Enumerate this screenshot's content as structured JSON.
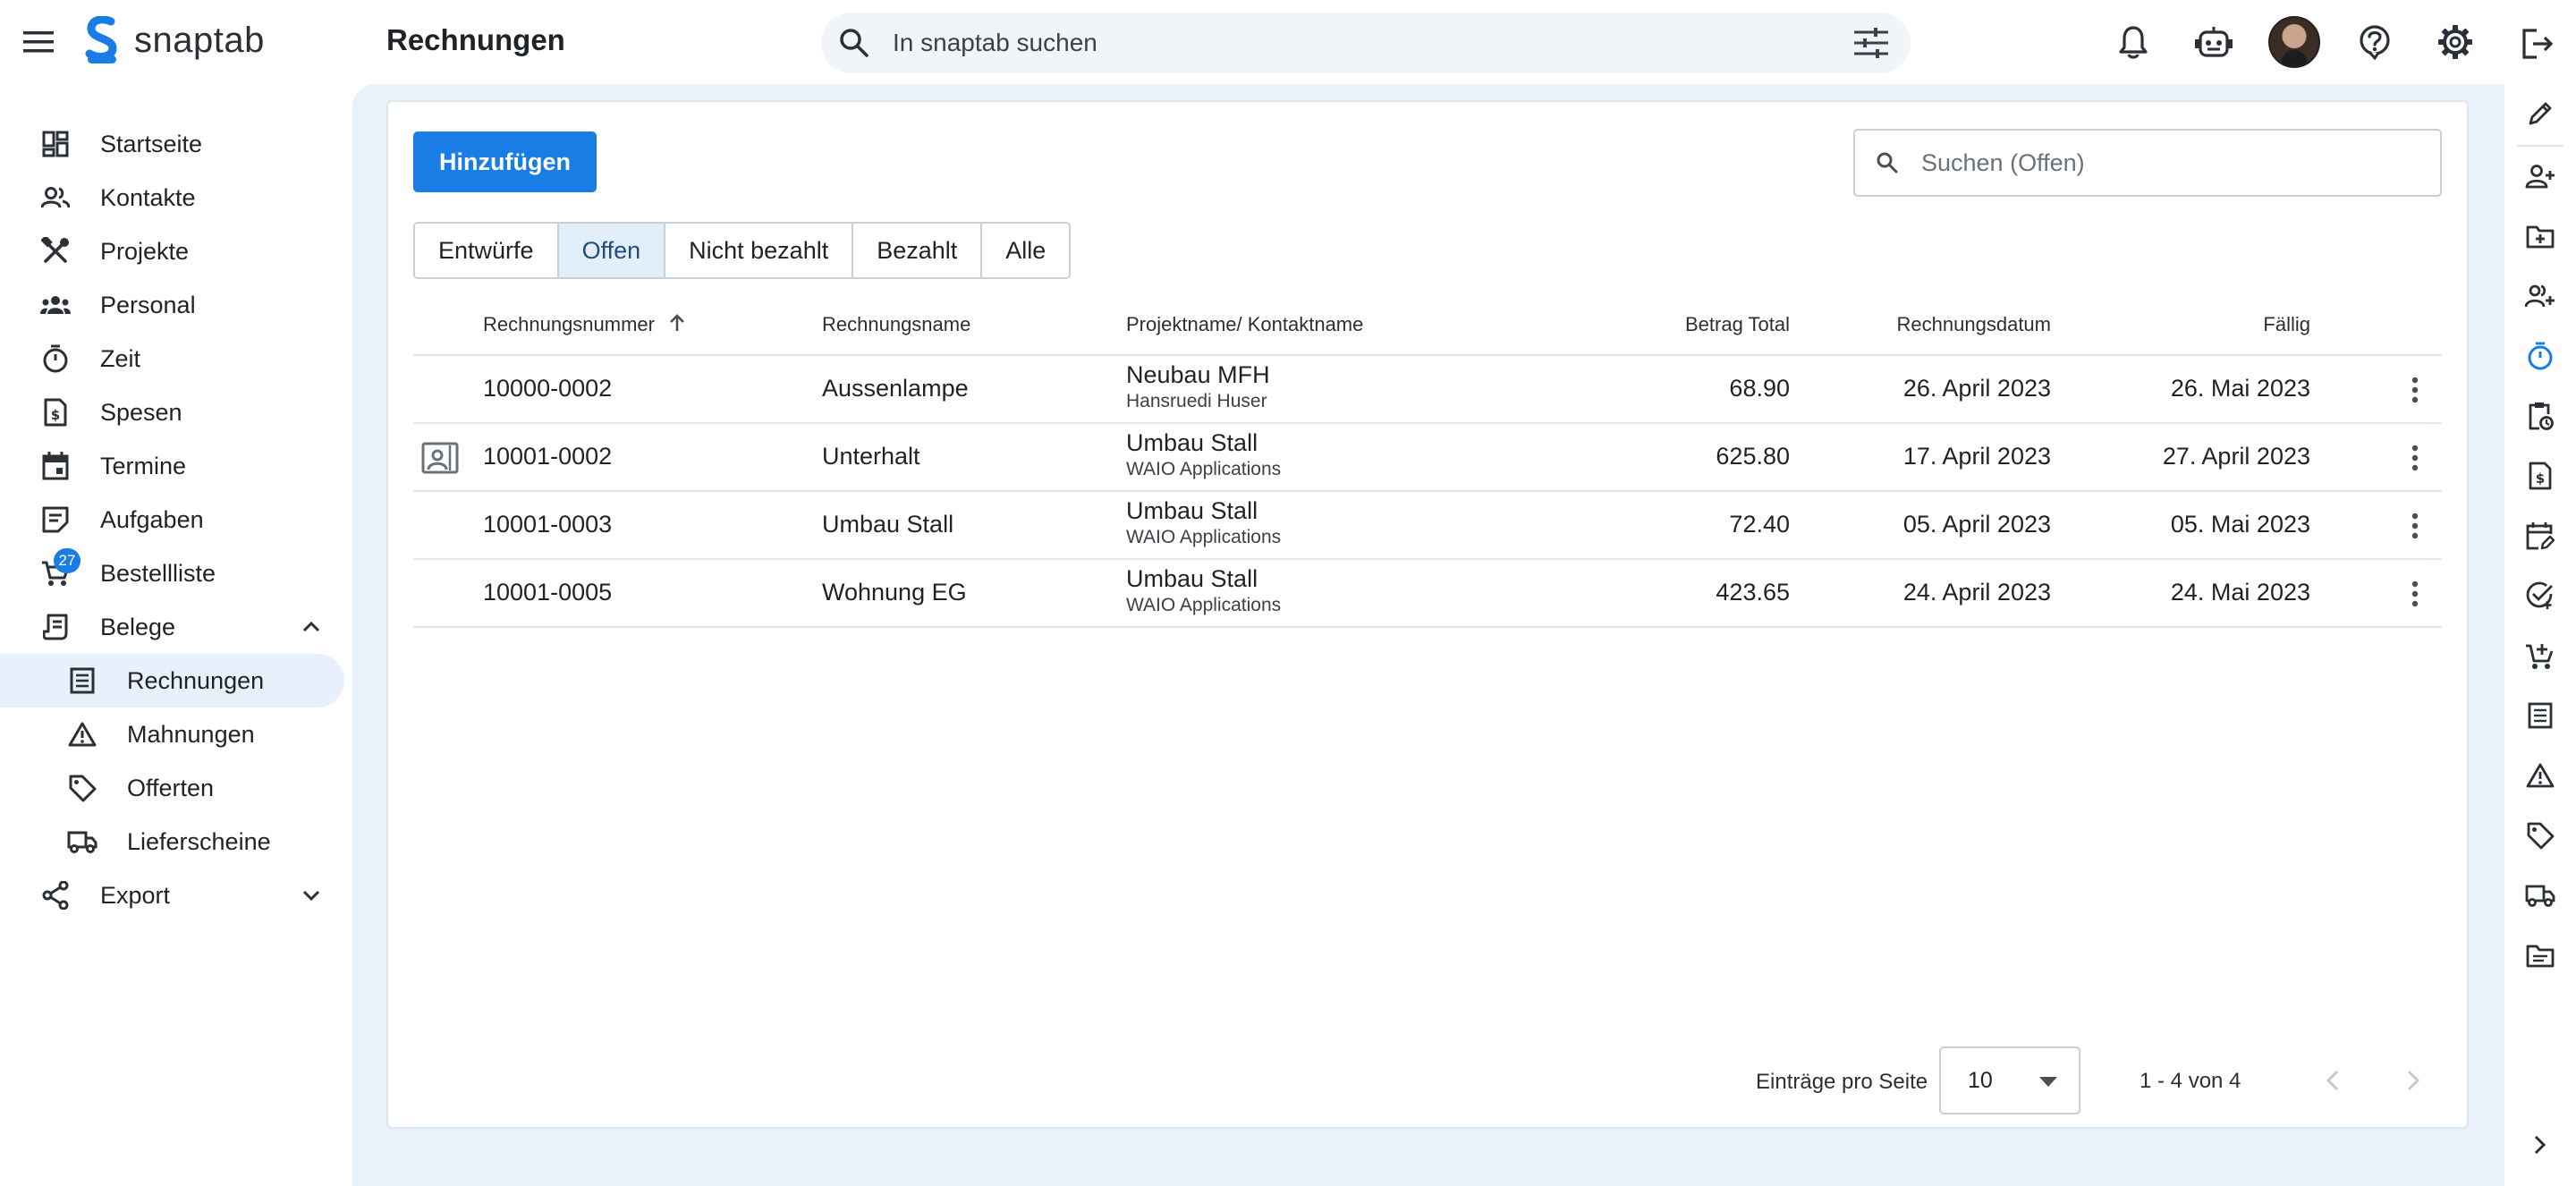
{
  "app": {
    "name": "snaptab",
    "page_title": "Rechnungen"
  },
  "global_search": {
    "placeholder": "In snaptab suchen"
  },
  "sidebar": {
    "items": [
      {
        "label": "Startseite",
        "icon": "dashboard-icon"
      },
      {
        "label": "Kontakte",
        "icon": "contacts-icon"
      },
      {
        "label": "Projekte",
        "icon": "tools-icon"
      },
      {
        "label": "Personal",
        "icon": "people-icon"
      },
      {
        "label": "Zeit",
        "icon": "timer-icon"
      },
      {
        "label": "Spesen",
        "icon": "receipt-icon"
      },
      {
        "label": "Termine",
        "icon": "calendar-icon"
      },
      {
        "label": "Aufgaben",
        "icon": "tasks-icon"
      },
      {
        "label": "Bestellliste",
        "icon": "cart-icon",
        "badge": "27"
      },
      {
        "label": "Belege",
        "icon": "documents-icon",
        "expanded": true
      },
      {
        "label": "Rechnungen",
        "icon": "invoice-icon",
        "active": true
      },
      {
        "label": "Mahnungen",
        "icon": "warning-icon"
      },
      {
        "label": "Offerten",
        "icon": "tag-icon"
      },
      {
        "label": "Lieferscheine",
        "icon": "truck-icon"
      },
      {
        "label": "Export",
        "icon": "share-icon",
        "expanded": false
      }
    ]
  },
  "toolbar": {
    "add_label": "Hinzufügen",
    "search_placeholder": "Suchen (Offen)"
  },
  "filters": {
    "tabs": [
      "Entwürfe",
      "Offen",
      "Nicht bezahlt",
      "Bezahlt",
      "Alle"
    ],
    "active": "Offen"
  },
  "table": {
    "columns": [
      "Rechnungsnummer",
      "Rechnungsname",
      "Projektname/ Kontaktname",
      "Betrag Total",
      "Rechnungsdatum",
      "Fällig"
    ],
    "sort": {
      "column": "Rechnungsnummer",
      "direction": "asc"
    },
    "rows": [
      {
        "number": "10000-0002",
        "name": "Aussenlampe",
        "project": "Neubau MFH",
        "contact": "Hansruedi Huser",
        "total": "68.90",
        "date": "26. April 2023",
        "due": "26. Mai 2023",
        "has_contact_icon": false
      },
      {
        "number": "10001-0002",
        "name": "Unterhalt",
        "project": "Umbau Stall",
        "contact": "WAIO Applications",
        "total": "625.80",
        "date": "17. April 2023",
        "due": "27. April 2023",
        "has_contact_icon": true
      },
      {
        "number": "10001-0003",
        "name": "Umbau Stall",
        "project": "Umbau Stall",
        "contact": "WAIO Applications",
        "total": "72.40",
        "date": "05. April 2023",
        "due": "05. Mai 2023",
        "has_contact_icon": false
      },
      {
        "number": "10001-0005",
        "name": "Wohnung EG",
        "project": "Umbau Stall",
        "contact": "WAIO Applications",
        "total": "423.65",
        "date": "24. April 2023",
        "due": "24. Mai 2023",
        "has_contact_icon": false
      }
    ]
  },
  "pagination": {
    "per_page_label": "Einträge pro Seite",
    "per_page": "10",
    "range": "1 - 4 von 4"
  },
  "right_rail": {
    "icons": [
      "edit-icon",
      "add-contact-icon",
      "add-folder-icon",
      "add-person-icon",
      "timer-icon",
      "clipboard-clock-icon",
      "receipt-icon",
      "calendar-edit-icon",
      "task-check-icon",
      "cart-add-icon",
      "invoice-icon",
      "warning-icon",
      "tag-icon",
      "truck-icon",
      "folder-icon",
      "chevron-right-icon"
    ]
  },
  "colors": {
    "accent": "#1a7de6",
    "main_background": "#e9f1fa",
    "active_nav": "#e8f1fb",
    "active_filter": "#e3eefb"
  }
}
